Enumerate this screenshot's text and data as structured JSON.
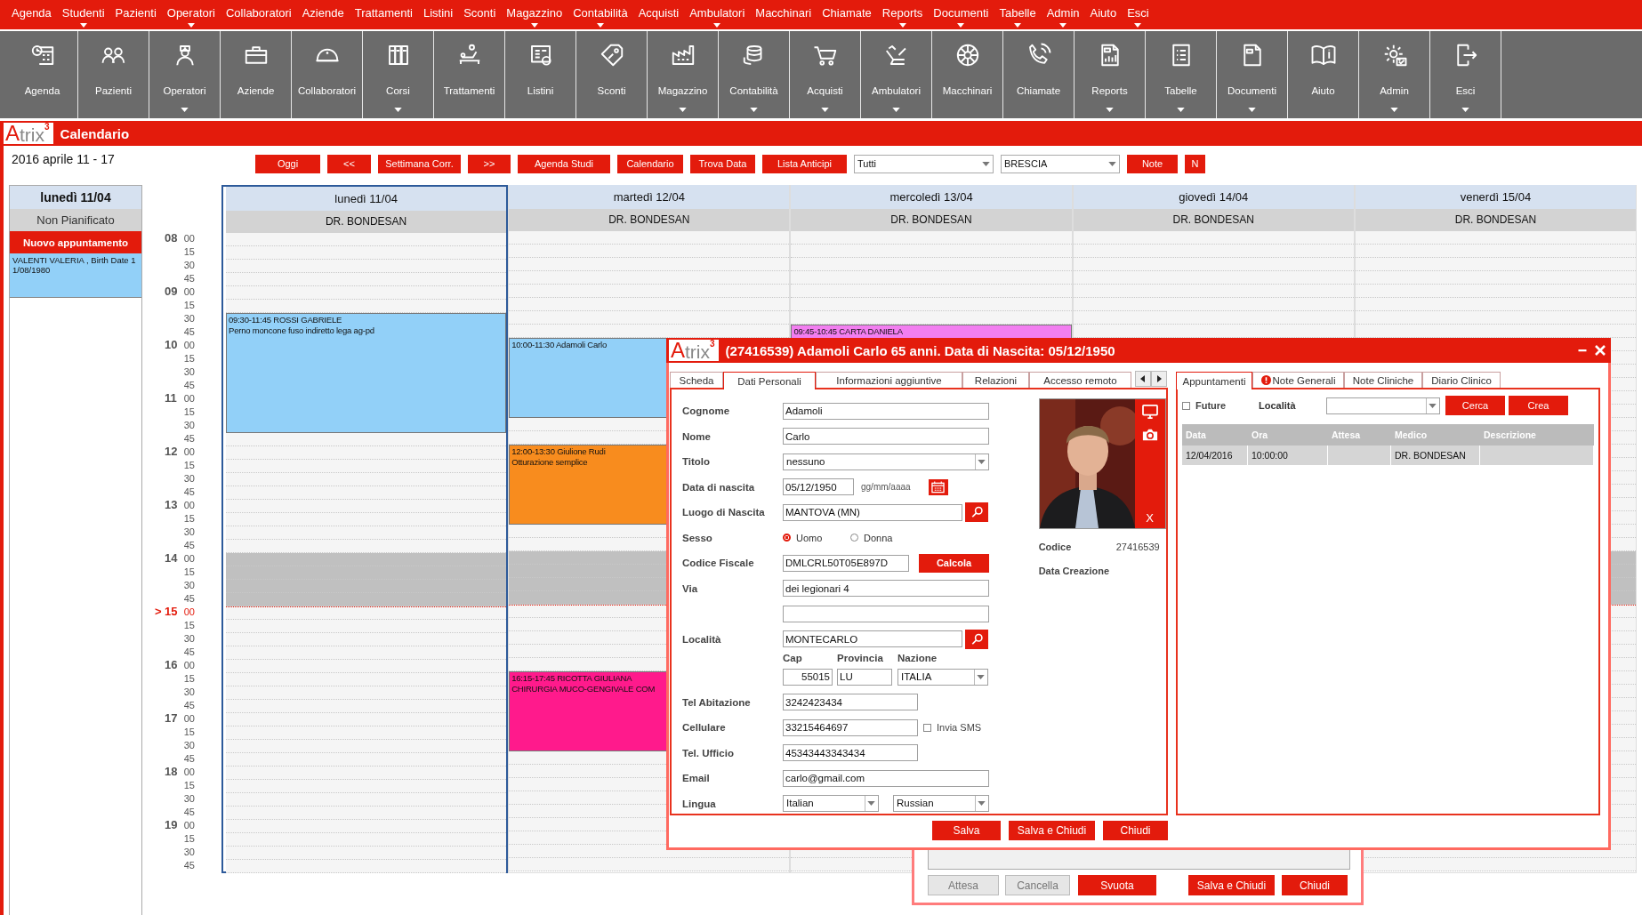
{
  "menu": [
    {
      "label": "Agenda",
      "dropdown": false
    },
    {
      "label": "Studenti",
      "dropdown": true
    },
    {
      "label": "Pazienti",
      "dropdown": false
    },
    {
      "label": "Operatori",
      "dropdown": true
    },
    {
      "label": "Collaboratori",
      "dropdown": false
    },
    {
      "label": "Aziende",
      "dropdown": false
    },
    {
      "label": "Trattamenti",
      "dropdown": false
    },
    {
      "label": "Listini",
      "dropdown": false
    },
    {
      "label": "Sconti",
      "dropdown": false
    },
    {
      "label": "Magazzino",
      "dropdown": true
    },
    {
      "label": "Contabilità",
      "dropdown": true
    },
    {
      "label": "Acquisti",
      "dropdown": false
    },
    {
      "label": "Ambulatori",
      "dropdown": true
    },
    {
      "label": "Macchinari",
      "dropdown": false
    },
    {
      "label": "Chiamate",
      "dropdown": false
    },
    {
      "label": "Reports",
      "dropdown": true
    },
    {
      "label": "Documenti",
      "dropdown": true
    },
    {
      "label": "Tabelle",
      "dropdown": true
    },
    {
      "label": "Admin",
      "dropdown": true
    },
    {
      "label": "Aiuto",
      "dropdown": false
    },
    {
      "label": "Esci",
      "dropdown": true
    }
  ],
  "toolbar": [
    {
      "label": "Agenda",
      "dropdown": false
    },
    {
      "label": "Pazienti",
      "dropdown": false
    },
    {
      "label": "Operatori",
      "dropdown": true
    },
    {
      "label": "Aziende",
      "dropdown": false
    },
    {
      "label": "Collaboratori",
      "dropdown": false
    },
    {
      "label": "Corsi",
      "dropdown": true
    },
    {
      "label": "Trattamenti",
      "dropdown": false
    },
    {
      "label": "Listini",
      "dropdown": false
    },
    {
      "label": "Sconti",
      "dropdown": false
    },
    {
      "label": "Magazzino",
      "dropdown": true
    },
    {
      "label": "Contabilità",
      "dropdown": true
    },
    {
      "label": "Acquisti",
      "dropdown": true
    },
    {
      "label": "Ambulatori",
      "dropdown": true
    },
    {
      "label": "Macchinari",
      "dropdown": false
    },
    {
      "label": "Chiamate",
      "dropdown": false
    },
    {
      "label": "Reports",
      "dropdown": true
    },
    {
      "label": "Tabelle",
      "dropdown": true
    },
    {
      "label": "Documenti",
      "dropdown": true
    },
    {
      "label": "Aiuto",
      "dropdown": false
    },
    {
      "label": "Admin",
      "dropdown": true
    },
    {
      "label": "Esci",
      "dropdown": true
    }
  ],
  "logo": {
    "initial": "A",
    "rest": "trix",
    "sup": "3"
  },
  "section_title": "Calendario",
  "controls": {
    "period": "2016 aprile 11 - 17",
    "buttons": [
      "Oggi",
      "<<",
      "Settimana Corr.",
      ">>",
      "Agenda Studi",
      "Calendario",
      "Trova Data",
      "Lista Anticipi"
    ],
    "selects": [
      "Tutti",
      "BRESCIA"
    ],
    "extra_buttons": [
      "Note",
      "N"
    ]
  },
  "unplanned": {
    "heading": "lunedì 11/04",
    "subheading": "Non Pianificato",
    "new_button": "Nuovo appuntamento",
    "items": [
      "VALENTI VALERIA , Birth Date 11/08/1980"
    ]
  },
  "now_marker": ">",
  "slots": [
    {
      "hour": "08",
      "minute": "00",
      "blocked": false,
      "current": false
    },
    {
      "minute": "15",
      "blocked": false,
      "current": false
    },
    {
      "minute": "30",
      "blocked": false,
      "current": false
    },
    {
      "minute": "45",
      "blocked": false,
      "current": false
    },
    {
      "hour": "09",
      "minute": "00",
      "blocked": false,
      "current": false
    },
    {
      "minute": "15",
      "blocked": false,
      "current": false
    },
    {
      "minute": "30",
      "blocked": false,
      "current": false
    },
    {
      "minute": "45",
      "blocked": false,
      "current": false
    },
    {
      "hour": "10",
      "minute": "00",
      "blocked": false,
      "current": false
    },
    {
      "minute": "15",
      "blocked": false,
      "current": false
    },
    {
      "minute": "30",
      "blocked": false,
      "current": false
    },
    {
      "minute": "45",
      "blocked": false,
      "current": false
    },
    {
      "hour": "11",
      "minute": "00",
      "blocked": false,
      "current": false
    },
    {
      "minute": "15",
      "blocked": false,
      "current": false
    },
    {
      "minute": "30",
      "blocked": false,
      "current": false
    },
    {
      "minute": "45",
      "blocked": false,
      "current": false
    },
    {
      "hour": "12",
      "minute": "00",
      "blocked": false,
      "current": false
    },
    {
      "minute": "15",
      "blocked": false,
      "current": false
    },
    {
      "minute": "30",
      "blocked": false,
      "current": false
    },
    {
      "minute": "45",
      "blocked": false,
      "current": false
    },
    {
      "hour": "13",
      "minute": "00",
      "blocked": false,
      "current": false
    },
    {
      "minute": "15",
      "blocked": false,
      "current": false
    },
    {
      "minute": "30",
      "blocked": false,
      "current": false
    },
    {
      "minute": "45",
      "blocked": false,
      "current": false
    },
    {
      "hour": "14",
      "minute": "00",
      "blocked": true,
      "current": false
    },
    {
      "minute": "15",
      "blocked": true,
      "current": false
    },
    {
      "minute": "30",
      "blocked": true,
      "current": false
    },
    {
      "minute": "45",
      "blocked": true,
      "current": false
    },
    {
      "hour": "15",
      "minute": "00",
      "blocked": false,
      "current": true
    },
    {
      "minute": "15",
      "blocked": false,
      "current": false
    },
    {
      "minute": "30",
      "blocked": false,
      "current": false
    },
    {
      "minute": "45",
      "blocked": false,
      "current": false
    },
    {
      "hour": "16",
      "minute": "00",
      "blocked": false,
      "current": false
    },
    {
      "minute": "15",
      "blocked": false,
      "current": false
    },
    {
      "minute": "30",
      "blocked": false,
      "current": false
    },
    {
      "minute": "45",
      "blocked": false,
      "current": false
    },
    {
      "hour": "17",
      "minute": "00",
      "blocked": false,
      "current": false
    },
    {
      "minute": "15",
      "blocked": false,
      "current": false
    },
    {
      "minute": "30",
      "blocked": false,
      "current": false
    },
    {
      "minute": "45",
      "blocked": false,
      "current": false
    },
    {
      "hour": "18",
      "minute": "00",
      "blocked": false,
      "current": false
    },
    {
      "minute": "15",
      "blocked": false,
      "current": false
    },
    {
      "minute": "30",
      "blocked": false,
      "current": false
    },
    {
      "minute": "45",
      "blocked": false,
      "current": false
    },
    {
      "hour": "19",
      "minute": "00",
      "blocked": false,
      "current": false
    },
    {
      "minute": "15",
      "blocked": false,
      "current": false
    },
    {
      "minute": "30",
      "blocked": false,
      "current": false
    },
    {
      "minute": "45",
      "blocked": false,
      "current": false
    }
  ],
  "days": [
    {
      "label": "lunedì 11/04",
      "doctor": "DR. BONDESAN",
      "selected": true,
      "appointments": [
        {
          "title": "09:30-11:45 ROSSI GABRIELE",
          "detail": "Perno moncone fuso indiretto lega ag-pd",
          "color": "#92d0f8"
        }
      ]
    },
    {
      "label": "martedì 12/04",
      "doctor": "DR. BONDESAN",
      "selected": false,
      "appointments": [
        {
          "title": "10:00-11:30 Adamoli Carlo",
          "color": "#92d0f8"
        },
        {
          "title": "12:00-13:30 Giulione Rudi",
          "detail": "Otturazione semplice",
          "color": "#f88c1e"
        },
        {
          "title": "16:15-17:45 RICOTTA GIULIANA",
          "detail": "CHIRURGIA MUCO-GENGIVALE COM",
          "color": "#ff1a8c"
        }
      ]
    },
    {
      "label": "mercoledì 13/04",
      "doctor": "DR. BONDESAN",
      "selected": false,
      "appointments": [
        {
          "title": "09:45-10:45 CARTA DANIELA",
          "color": "#f27ef0"
        }
      ]
    },
    {
      "label": "giovedì 14/04",
      "doctor": "DR. BONDESAN",
      "selected": false
    },
    {
      "label": "venerdì 15/04",
      "doctor": "DR. BONDESAN",
      "selected": false
    }
  ],
  "back_dialog": {
    "buttons": [
      {
        "label": "Attesa",
        "disabled": true
      },
      {
        "label": "Cancella",
        "disabled": true
      },
      {
        "label": "Svuota",
        "disabled": false
      },
      {
        "label": "Salva e Chiudi",
        "disabled": false
      },
      {
        "label": "Chiudi",
        "disabled": false
      }
    ]
  },
  "patient_dialog": {
    "logo": {
      "initial": "A",
      "rest": "trix",
      "sup": "3"
    },
    "title": "(27416539) Adamoli Carlo 65 anni. Data di Nascita: 05/12/1950",
    "tabs": [
      {
        "label": "Scheda",
        "selected": false
      },
      {
        "label": "Dati Personali",
        "selected": true
      },
      {
        "label": "Informazioni aggiuntive",
        "selected": false
      },
      {
        "label": "Relazioni",
        "selected": false
      },
      {
        "label": "Accesso remoto",
        "selected": false
      }
    ],
    "form": {
      "cognome": {
        "label": "Cognome",
        "value": "Adamoli"
      },
      "nome": {
        "label": "Nome",
        "value": "Carlo"
      },
      "titolo": {
        "label": "Titolo",
        "value": "nessuno"
      },
      "data_nascita": {
        "label": "Data di nascita",
        "value": "05/12/1950",
        "hint": "gg/mm/aaaa"
      },
      "luogo_nascita": {
        "label": "Luogo di Nascita",
        "value": "MANTOVA (MN)"
      },
      "sesso": {
        "label": "Sesso",
        "options": [
          {
            "label": "Uomo",
            "selected": true
          },
          {
            "label": "Donna",
            "selected": false
          }
        ]
      },
      "codice_fiscale": {
        "label": "Codice Fiscale",
        "value": "DMLCRL50T05E897D",
        "button": "Calcola"
      },
      "via": {
        "label": "Via",
        "value": "dei legionari 4"
      },
      "localita": {
        "label": "Località",
        "value": "MONTECARLO"
      },
      "cap": {
        "label": "Cap",
        "value": "55015"
      },
      "provincia": {
        "label": "Provincia",
        "value": "LU"
      },
      "nazione": {
        "label": "Nazione",
        "value": "ITALIA"
      },
      "tel_abitazione": {
        "label": "Tel Abitazione",
        "value": "3242423434"
      },
      "cellulare": {
        "label": "Cellulare",
        "value": "33215464697"
      },
      "invia_sms": {
        "label": "Invia SMS",
        "checked": false
      },
      "tel_ufficio": {
        "label": "Tel. Ufficio",
        "value": "45343443343434"
      },
      "email": {
        "label": "Email",
        "value": "carlo@gmail.com"
      },
      "lingua": {
        "label": "Lingua",
        "values": [
          "Italian",
          "Russian"
        ]
      }
    },
    "photo": {
      "kind": "picture",
      "remove": "X"
    },
    "codice": {
      "label": "Codice",
      "value": "27416539"
    },
    "data_creazione": {
      "label": "Data Creazione"
    },
    "buttons": [
      "Salva",
      "Salva e Chiudi",
      "Chiudi"
    ],
    "side_tabs": [
      {
        "label": "Appuntamenti",
        "selected": true,
        "alert": false
      },
      {
        "label": "Note Generali",
        "selected": false,
        "alert": true
      },
      {
        "label": "Note Cliniche",
        "selected": false,
        "alert": false
      },
      {
        "label": "Diario Clinico",
        "selected": false,
        "alert": false
      }
    ],
    "filter": {
      "future": {
        "label": "Future",
        "checked": false
      },
      "localita_label": "Località",
      "search": "Cerca",
      "create": "Crea"
    },
    "table": {
      "columns": [
        "Data",
        "Ora",
        "Attesa",
        "Medico",
        "Descrizione"
      ],
      "rows": [
        [
          "12/04/2016",
          "10:00:00",
          null,
          "DR. BONDESAN",
          null
        ]
      ]
    }
  }
}
